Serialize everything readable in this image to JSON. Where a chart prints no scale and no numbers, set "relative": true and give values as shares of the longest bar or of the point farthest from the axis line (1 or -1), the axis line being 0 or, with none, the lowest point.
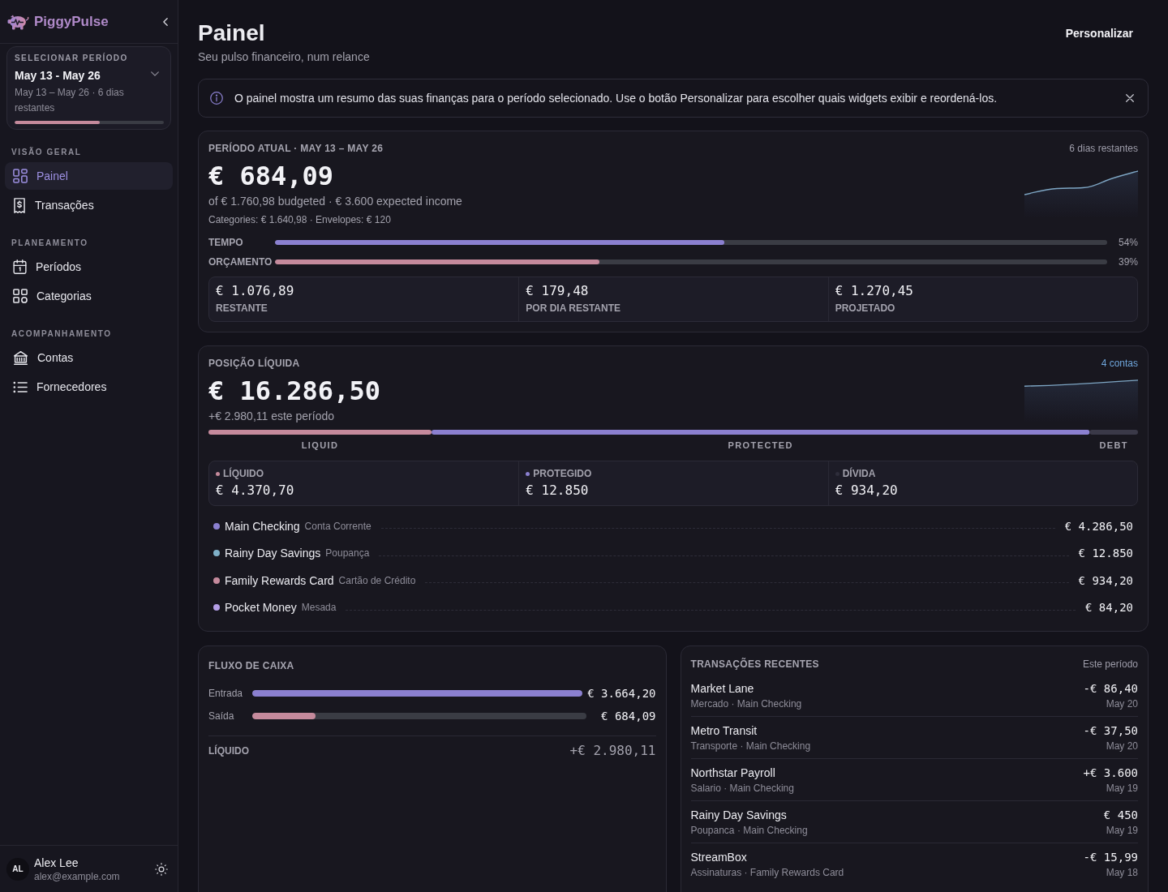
{
  "sidebar": {
    "brand": "PiggyPulse",
    "period_selector": {
      "label": "SELECIONAR PERÍODO",
      "value": "May 13 - May 26",
      "detail": "May 13 – May 26 · 6 dias restantes",
      "level": 0.57
    },
    "sections": [
      {
        "title": "VISÃO GERAL",
        "items": [
          {
            "label": "Painel",
            "selected": true
          },
          {
            "label": "Transações",
            "selected": false
          }
        ]
      },
      {
        "title": "PLANEAMENTO",
        "items": [
          {
            "label": "Períodos",
            "selected": false
          },
          {
            "label": "Categorias",
            "selected": false
          }
        ]
      },
      {
        "title": "ACOMPANHAMENTO",
        "items": [
          {
            "label": "Contas",
            "selected": false
          },
          {
            "label": "Fornecedores",
            "selected": false
          }
        ]
      }
    ],
    "user": {
      "initials": "AL",
      "name": "Alex Lee",
      "email": "alex@example.com"
    }
  },
  "header": {
    "title": "Painel",
    "subtitle": "Seu pulso financeiro, num relance",
    "button": "Personalizar"
  },
  "notice": {
    "text": "O painel mostra um resumo das suas finanças para o período selecionado. Use o botão Personalizar para escolher quais widgets exibir e reordená-los."
  },
  "current_period": {
    "title": "PERÍODO ATUAL · MAY 13 – MAY 26",
    "days_left": "6 dias restantes",
    "amount": "€ 684,09",
    "summary": "of € 1.760,98 budgeted · € 3.600 expected income",
    "breakdown": "Categories: € 1.640,98 · Envelopes: € 120",
    "progress": [
      {
        "label": "TEMPO",
        "level": 0.54,
        "reading": "54%",
        "color": "#8b80d0"
      },
      {
        "label": "ORÇAMENTO",
        "level": 0.39,
        "reading": "39%",
        "color": "#c58a9c"
      }
    ],
    "stats": [
      {
        "value": "€ 1.076,89",
        "label": "RESTANTE"
      },
      {
        "value": "€ 179,48",
        "label": "POR DIA RESTANTE"
      },
      {
        "value": "€ 1.270,45",
        "label": "PROJETADO"
      }
    ]
  },
  "net_position": {
    "title": "POSIÇÃO LÍQUIDA",
    "link": "4 contas",
    "amount": "€ 16.286,50",
    "change": "+€ 2.980,11 este período",
    "composition": {
      "chart_data": {
        "type": "bar",
        "orientation": "horizontal",
        "stacked": true,
        "relative": true,
        "series": [
          {
            "name": "LIQUID",
            "color": "#c58a9c",
            "values": [
              0.24
            ]
          },
          {
            "name": "PROTECTED",
            "color": "#8b80d0",
            "values": [
              0.708
            ]
          },
          {
            "name": "DEBT",
            "color": "#3a3948",
            "values": [
              0.052
            ]
          }
        ]
      }
    },
    "balances": [
      {
        "label": "LÍQUIDO",
        "value": "€ 4.370,70",
        "color": "#c58a9c"
      },
      {
        "label": "PROTEGIDO",
        "value": "€ 12.850",
        "color": "#8b80d0"
      },
      {
        "label": "DÍVIDA",
        "value": "€ 934,20",
        "color": "#2e2d3a"
      }
    ],
    "accounts": [
      {
        "name": "Main Checking",
        "type": "Conta Corrente",
        "amount": "€ 4.286,50",
        "color": "#8b80d0"
      },
      {
        "name": "Rainy Day Savings",
        "type": "Poupança",
        "amount": "€ 12.850",
        "color": "#7fb0c8"
      },
      {
        "name": "Family Rewards Card",
        "type": "Cartão de Crédito",
        "amount": "€ 934,20",
        "color": "#c58a9c"
      },
      {
        "name": "Pocket Money",
        "type": "Mesada",
        "amount": "€ 84,20",
        "color": "#b49ee6"
      }
    ]
  },
  "cash_flow": {
    "title": "FLUXO DE CAIXA",
    "rows": [
      {
        "label": "Entrada",
        "level": 1,
        "amount": "€ 3.664,20",
        "color": "#8b80d0"
      },
      {
        "label": "Saída",
        "level": 0.19,
        "amount": "€ 684,09",
        "color": "#c58a9c"
      }
    ],
    "net": {
      "label": "LÍQUIDO",
      "amount": "+€ 2.980,11"
    }
  },
  "recent_transactions": {
    "title": "TRANSAÇÕES RECENTES",
    "period": "Este período",
    "items": [
      {
        "name": "Market Lane",
        "meta": "Mercado · Main Checking",
        "amount": "-€ 86,40",
        "date": "May 20"
      },
      {
        "name": "Metro Transit",
        "meta": "Transporte · Main Checking",
        "amount": "-€ 37,50",
        "date": "May 20"
      },
      {
        "name": "Northstar Payroll",
        "meta": "Salario · Main Checking",
        "amount": "+€ 3.600",
        "date": "May 19"
      },
      {
        "name": "Rainy Day Savings",
        "meta": "Poupanca · Main Checking",
        "amount": "€ 450",
        "date": "May 19"
      },
      {
        "name": "StreamBox",
        "meta": "Assinaturas · Family Rewards Card",
        "amount": "-€ 15,99",
        "date": "May 18"
      }
    ]
  }
}
